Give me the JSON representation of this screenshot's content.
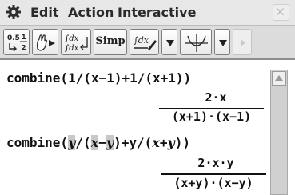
{
  "menubar": {
    "icon": "gear-icon",
    "items": [
      "Edit",
      "Action",
      "Interactive"
    ],
    "close_icon": "close-icon"
  },
  "toolbar": {
    "buttons": [
      {
        "name": "fraction-decimal-toggle-icon",
        "label": "0.5 ↔ 1/2"
      },
      {
        "name": "stylus-mode-icon"
      },
      {
        "name": "integral-toggle-icon"
      },
      {
        "name": "simp-button",
        "label": "Simp"
      },
      {
        "name": "integral-stylus-icon"
      },
      {
        "name": "dropdown-arrow-icon"
      },
      {
        "name": "graph-axes-icon"
      },
      {
        "name": "dropdown-arrow-icon"
      },
      {
        "name": "play-next-icon"
      }
    ]
  },
  "workspace": {
    "line1_input": "combine(1/(x−1)+1/(x+1))",
    "line1_num": "2·x",
    "line1_den": "(x+1)·(x−1)",
    "line2_input_prefix": "combine(",
    "line2_input_italic1": "y",
    "line2_input_mid1": "/(",
    "line2_input_italic2": "x",
    "line2_input_mid2": "−",
    "line2_input_italic3": "y",
    "line2_input_mid3": ")+y/(",
    "line2_input_italic4": "x",
    "line2_input_mid4": "+",
    "line2_input_italic5": "y",
    "line2_input_suffix": "))",
    "line2_num": "2·x·y",
    "line2_den": "(x+y)·(x−y)"
  },
  "colors": {
    "menubar_bg": "#e7e7e7",
    "toolbar_bg": "#dcdcdc",
    "selection": "#c8c8c8"
  }
}
